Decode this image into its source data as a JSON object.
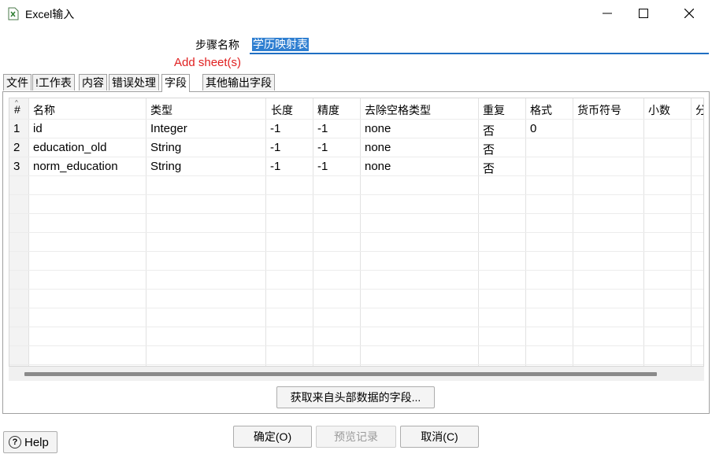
{
  "window": {
    "title": "Excel输入"
  },
  "step": {
    "label": "步骤名称",
    "value": "学历映射表"
  },
  "add_sheet": "Add sheet(s)",
  "tabs": [
    {
      "label": "文件"
    },
    {
      "label": "!工作表"
    },
    {
      "label": "内容"
    },
    {
      "label": "错误处理"
    },
    {
      "label": "字段",
      "active": true
    },
    {
      "label": "其他输出字段"
    }
  ],
  "table": {
    "headers": [
      "#",
      "名称",
      "类型",
      "长度",
      "精度",
      "去除空格类型",
      "重复",
      "格式",
      "货币符号",
      "小数",
      "分"
    ],
    "rows": [
      [
        "1",
        "id",
        "Integer",
        "-1",
        "-1",
        "none",
        "否",
        "0",
        "",
        "",
        ""
      ],
      [
        "2",
        "education_old",
        "String",
        "-1",
        "-1",
        "none",
        "否",
        "",
        "",
        "",
        ""
      ],
      [
        "3",
        "norm_education",
        "String",
        "-1",
        "-1",
        "none",
        "否",
        "",
        "",
        "",
        ""
      ]
    ]
  },
  "buttons": {
    "get_fields": "获取来自头部数据的字段...",
    "ok": "确定(O)",
    "preview": "预览记录",
    "cancel": "取消(C)",
    "help": "Help"
  }
}
